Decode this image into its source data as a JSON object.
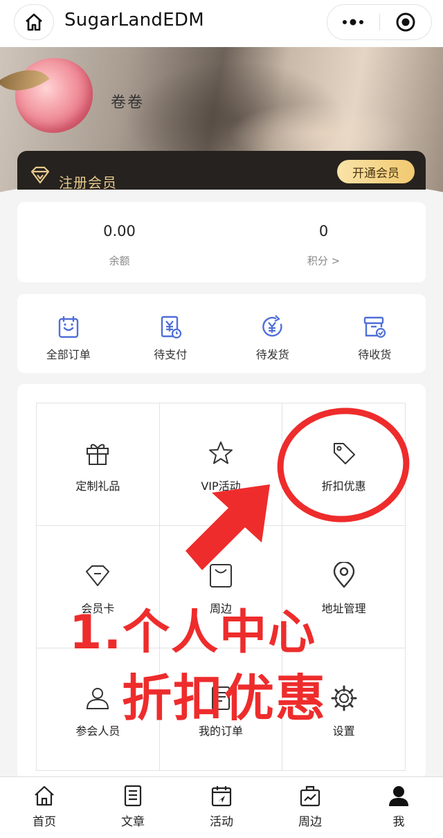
{
  "header": {
    "title": "SugarLandEDM"
  },
  "profile": {
    "username": "卷卷",
    "register_label": "注册会员",
    "open_member_label": "开通会员"
  },
  "stats": [
    {
      "value": "0.00",
      "label": "余额"
    },
    {
      "value": "0",
      "label": "积分 >"
    }
  ],
  "orders": [
    {
      "label": "全部订单",
      "icon": "order-list-icon"
    },
    {
      "label": "待支付",
      "icon": "pending-payment-icon"
    },
    {
      "label": "待发货",
      "icon": "pending-shipment-icon"
    },
    {
      "label": "待收货",
      "icon": "pending-receipt-icon"
    }
  ],
  "grid": [
    {
      "label": "定制礼品",
      "icon": "gift-icon"
    },
    {
      "label": "VIP活动",
      "icon": "star-icon"
    },
    {
      "label": "折扣优惠",
      "icon": "tag-icon"
    },
    {
      "label": "会员卡",
      "icon": "diamond-icon"
    },
    {
      "label": "周边",
      "icon": "shopping-bag-icon"
    },
    {
      "label": "地址管理",
      "icon": "location-pin-icon"
    },
    {
      "label": "参会人员",
      "icon": "person-icon"
    },
    {
      "label": "我的订单",
      "icon": "document-icon"
    },
    {
      "label": "设置",
      "icon": "gear-icon"
    }
  ],
  "annotation": {
    "line1": "1.个人中心",
    "line2": "折扣优惠",
    "color": "#ee2c2c"
  },
  "tabbar": [
    {
      "label": "首页",
      "icon": "home-icon"
    },
    {
      "label": "文章",
      "icon": "article-icon"
    },
    {
      "label": "活动",
      "icon": "calendar-icon"
    },
    {
      "label": "周边",
      "icon": "merch-icon"
    },
    {
      "label": "我",
      "icon": "me-icon",
      "active": true
    }
  ],
  "colors": {
    "accent_gold": "#f1c970",
    "icon_blue": "#4f6fd8",
    "member_bar": "#26221f"
  }
}
